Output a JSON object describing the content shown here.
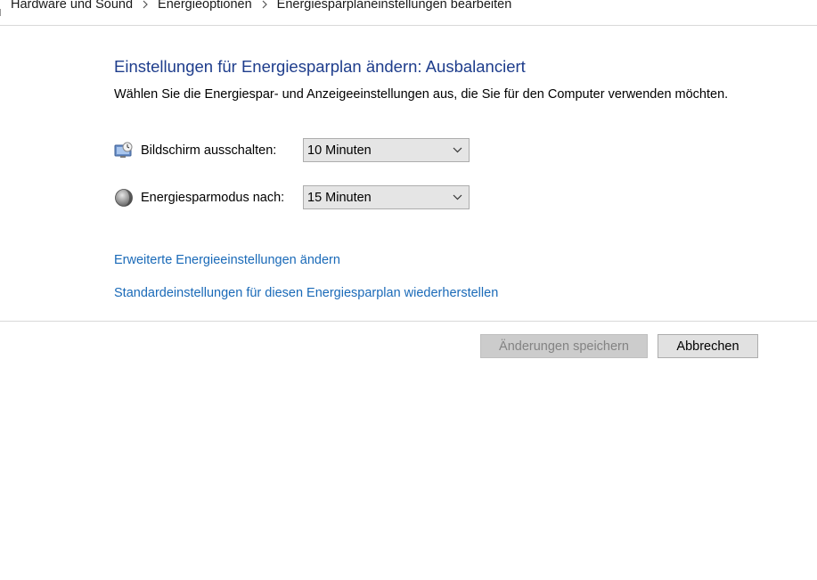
{
  "breadcrumb": {
    "items": [
      {
        "label": "Hardware und Sound"
      },
      {
        "label": "Energieoptionen"
      },
      {
        "label": "Energiesparplaneinstellungen bearbeiten"
      }
    ]
  },
  "main": {
    "title": "Einstellungen für Energiesparplan ändern: Ausbalanciert",
    "subtitle": "Wählen Sie die Energiespar- und Anzeigeeinstellungen aus, die Sie für den Computer verwenden möchten.",
    "settings": [
      {
        "label": "Bildschirm ausschalten:",
        "value": "10 Minuten",
        "icon": "display-off-icon"
      },
      {
        "label": "Energiesparmodus nach:",
        "value": "15 Minuten",
        "icon": "sleep-moon-icon"
      }
    ],
    "links": {
      "advanced": "Erweiterte Energieeinstellungen ändern",
      "restore": "Standardeinstellungen für diesen Energiesparplan wiederherstellen"
    }
  },
  "buttons": {
    "save": "Änderungen speichern",
    "cancel": "Abbrechen"
  },
  "colors": {
    "title": "#1e3d8c",
    "link": "#1a6ab8",
    "disabled_text": "#838383"
  }
}
